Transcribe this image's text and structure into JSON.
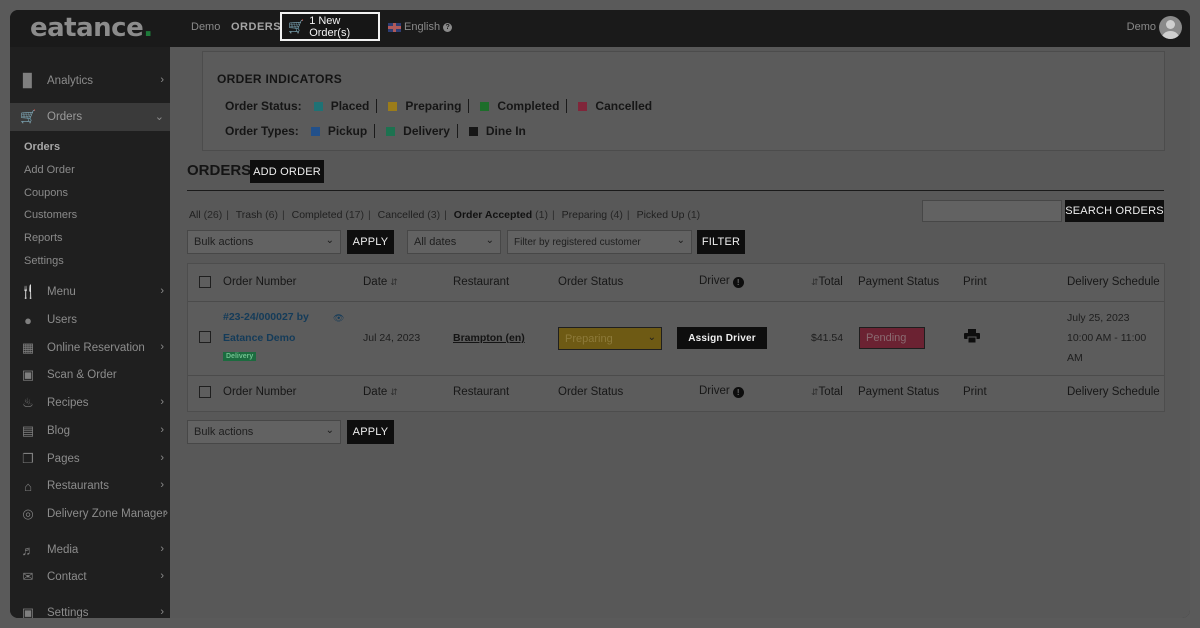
{
  "topbar": {
    "logo": "eatance",
    "logo_dot": ".",
    "links": [
      "Demo",
      "ORDERS"
    ],
    "new_order": "1 New Order(s)",
    "language": "English",
    "user": "Demo"
  },
  "sidebar": {
    "items": [
      {
        "label": "Analytics",
        "icon": "chart-bar-icon"
      },
      {
        "label": "Orders",
        "icon": "cart-icon"
      },
      {
        "label": "Menu",
        "icon": "utensils-icon"
      },
      {
        "label": "Users",
        "icon": "user-icon"
      },
      {
        "label": "Online Reservation",
        "icon": "calendar-icon"
      },
      {
        "label": "Scan & Order",
        "icon": "qr-icon"
      },
      {
        "label": "Recipes",
        "icon": "cooking-pot-icon"
      },
      {
        "label": "Blog",
        "icon": "newspaper-icon"
      },
      {
        "label": "Pages",
        "icon": "pages-icon"
      },
      {
        "label": "Restaurants",
        "icon": "store-icon"
      },
      {
        "label": "Delivery Zone Manager",
        "icon": "globe-icon"
      },
      {
        "label": "Media",
        "icon": "media-icon"
      },
      {
        "label": "Contact",
        "icon": "envelope-icon"
      },
      {
        "label": "Settings",
        "icon": "settings-icon"
      }
    ],
    "orders_sub": [
      "Orders",
      "Add Order",
      "Coupons",
      "Customers",
      "Reports",
      "Settings"
    ]
  },
  "indicators": {
    "title": "ORDER INDICATORS",
    "status_label": "Order Status:",
    "statuses": [
      {
        "label": "Placed",
        "color": "#1f7275"
      },
      {
        "label": "Preparing",
        "color": "#9b7c1a"
      },
      {
        "label": "Completed",
        "color": "#1d6e2a"
      },
      {
        "label": "Cancelled",
        "color": "#80263a"
      }
    ],
    "types_label": "Order Types:",
    "types": [
      {
        "label": "Pickup",
        "color": "#22508a"
      },
      {
        "label": "Delivery",
        "color": "#1d7250"
      },
      {
        "label": "Dine In",
        "color": "#161616"
      }
    ]
  },
  "orders": {
    "title": "ORDERS",
    "add_order": "ADD ORDER",
    "filters": [
      {
        "label": "All",
        "count": "(26)"
      },
      {
        "label": "Trash",
        "count": "(6)"
      },
      {
        "label": "Completed",
        "count": "(17)"
      },
      {
        "label": "Cancelled",
        "count": "(3)"
      },
      {
        "label": "Order Accepted",
        "count": "(1)"
      },
      {
        "label": "Preparing",
        "count": "(4)"
      },
      {
        "label": "Picked Up",
        "count": "(1)"
      }
    ],
    "search_button": "SEARCH ORDERS",
    "bulk_actions": "Bulk actions",
    "apply": "APPLY",
    "all_dates": "All dates",
    "customer_filter": "Filter by registered customer",
    "filter_button": "FILTER",
    "columns": [
      "Order Number",
      "Date",
      "Restaurant",
      "Order Status",
      "Driver",
      "Total",
      "Payment Status",
      "Print",
      "Delivery Schedule"
    ],
    "row": {
      "order_number": "#23-24/000027 by",
      "customer": "Eatance Demo",
      "type_badge": "Delivery",
      "date": "Jul 24, 2023",
      "restaurant": "Brampton (en)",
      "status": "Preparing",
      "driver_button": "Assign Driver",
      "total": "$41.54",
      "payment": "Pending",
      "schedule_date": "July 25, 2023",
      "schedule_time": "10:00 AM - 11:00",
      "schedule_ampm": "AM"
    }
  }
}
